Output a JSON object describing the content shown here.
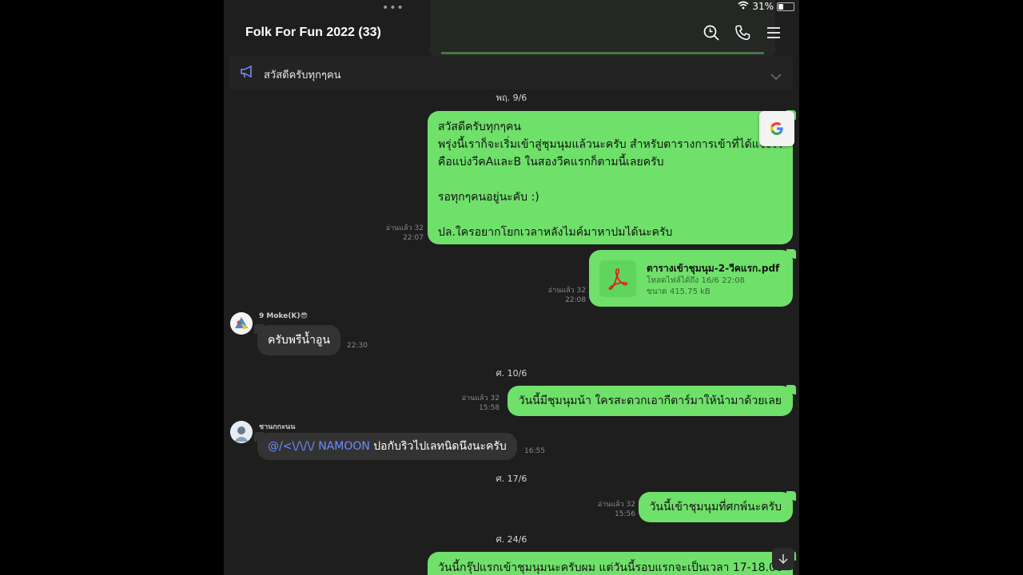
{
  "status": {
    "battery_text": "31%",
    "battery_level": 0.31
  },
  "header": {
    "title": "Folk For Fun 2022 (33)"
  },
  "announcement": {
    "text": "สวัสดีครับทุกๆคน"
  },
  "dates": [
    "พฤ. 9/6",
    "ศ. 10/6",
    "ศ. 17/6",
    "ศ. 24/6"
  ],
  "messages": {
    "m1": {
      "lines": [
        "สวัสดีครับทุกๆคน",
        "พรุ่งนี้เราก็จะเริ่มเข้าสู่ชุมนุมแล้วนะครับ สำหรับตารางการเข้าที่ได้แจ้งไว้",
        "คือแบ่งวีคAและB ในสองวีคแรกก็ตามนี้เลยครับ",
        "",
        "รอทุกๆคนอยู่นะคับ :)",
        "",
        "ปล.ใครอยากโยกเวลาหลังไมค์มาหาปมได้นะครับ"
      ],
      "read": "อ่านแล้ว 32",
      "time": "22:07"
    },
    "m2": {
      "file_name": "ตารางเข้าชุมนุม-2-วีคแรก.pdf",
      "expiry": "โหลดไฟล์ได้ถึง 16/6 22:08",
      "size": "ขนาด 415.75 kB",
      "read": "อ่านแล้ว 32",
      "time": "22:08"
    },
    "m3": {
      "sender": "9 Moke(K)😎",
      "text": "ครับพรีน้ำอูน",
      "time": "22:30"
    },
    "m4": {
      "text": "วันนี้มีชุมนุมน้า ใครสะดวกเอากีตาร์มาให้นำมาด้วยเลย",
      "read": "อ่านแล้ว 32",
      "time": "15:58"
    },
    "m5": {
      "sender": "ชานกกะนน",
      "mention": "@/<\\/\\/\\/ NAMOON",
      "text": " ปอกับริวไปเลทนิดนึงนะครับ",
      "time": "16:55"
    },
    "m6": {
      "text": "วันนี้เข้าชุมนุมที่ศกพ์นะครับ",
      "read": "อ่านแล้ว 32",
      "time": "15:56"
    },
    "m7": {
      "text": "วันนี้กรุ๊ปแรกเข้าชุมนุมนะครับผม แต่วันนี้รอบแรกจะเป็นเวลา 17-18.00"
    }
  },
  "colors": {
    "outgoing_bubble": "#6fe06a",
    "incoming_bubble": "#333333",
    "background": "#1e1e1e",
    "mention": "#6f8cff"
  },
  "icons": [
    "search-clock-icon",
    "phone-icon",
    "menu-icon",
    "megaphone-icon",
    "chevron-down-icon",
    "google-translate-icon",
    "pdf-icon",
    "scroll-down-icon",
    "wifi-icon",
    "battery-icon"
  ]
}
